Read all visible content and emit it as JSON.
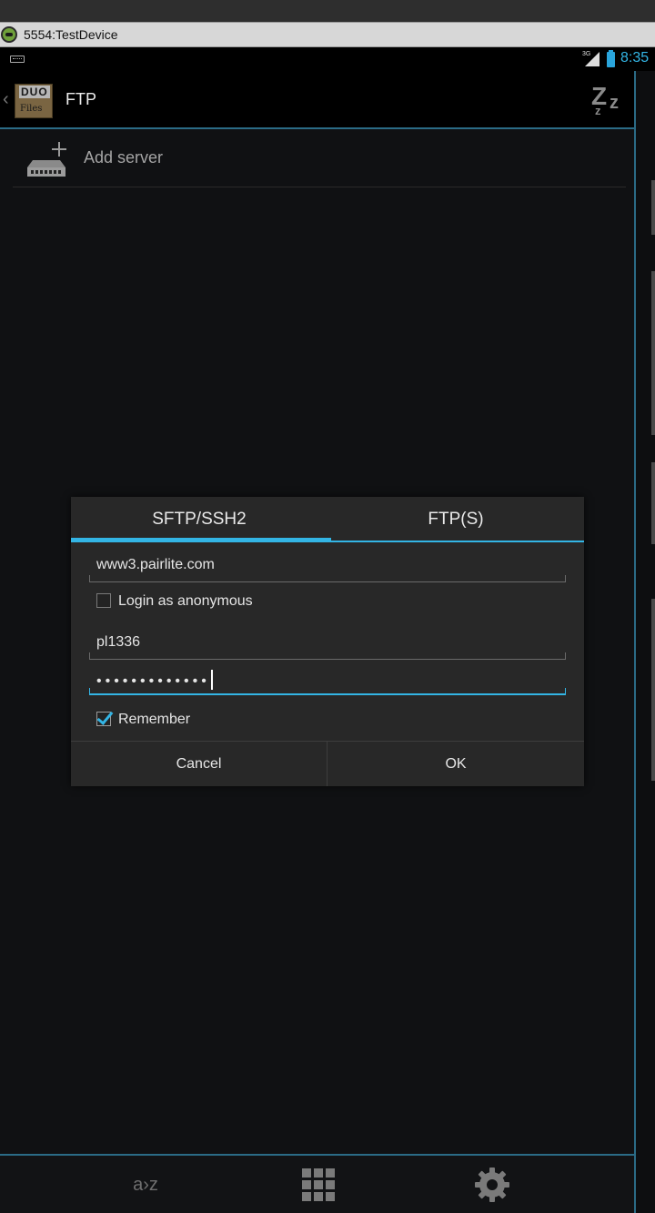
{
  "window": {
    "title": "5554:TestDevice"
  },
  "status_bar": {
    "network_label": "3G",
    "time": "8:35"
  },
  "action_bar": {
    "logo_line1": "DUO",
    "logo_line2": "Files",
    "title": "FTP"
  },
  "list": {
    "add_server_label": "Add server"
  },
  "dialog": {
    "tabs": [
      {
        "label": "SFTP/SSH2",
        "selected": true
      },
      {
        "label": "FTP(S)",
        "selected": false
      }
    ],
    "host_value": "www3.pairlite.com",
    "anonymous": {
      "label": "Login as anonymous",
      "checked": false
    },
    "username_value": "pl1336",
    "password_masked": "•••••••••••••",
    "remember": {
      "label": "Remember",
      "checked": true
    },
    "cancel_label": "Cancel",
    "ok_label": "OK"
  },
  "bottom_bar": {
    "sort_label": "a›z"
  },
  "colors": {
    "accent": "#33b5e5",
    "divider": "#2b6b86",
    "dialog_bg": "#282828"
  }
}
